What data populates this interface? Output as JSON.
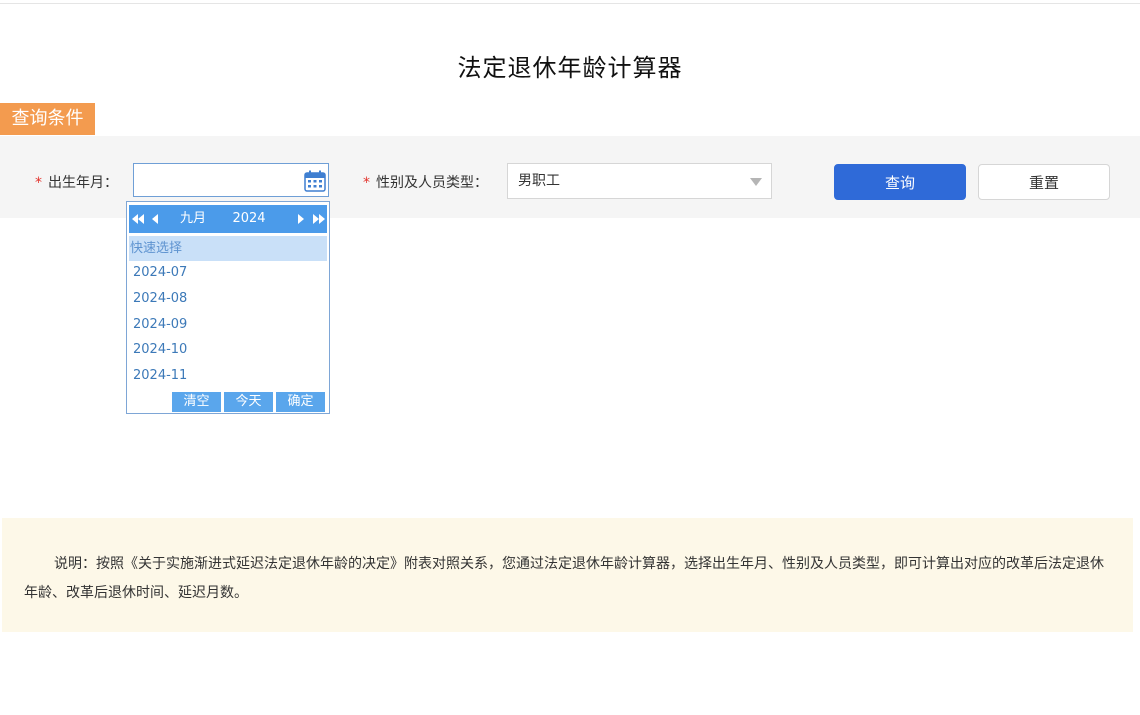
{
  "page": {
    "title": "法定退休年龄计算器"
  },
  "section": {
    "query_conditions": "查询条件"
  },
  "form": {
    "required_mark": "*",
    "birth_label": "出生年月：",
    "birth_value": "",
    "gender_label": "性别及人员类型：",
    "gender_selected": "男职工",
    "query_button": "查询",
    "reset_button": "重置"
  },
  "date_picker": {
    "month": "九月",
    "year": "2024",
    "quick_select_title": "快速选择",
    "quick_options": [
      "2024-07",
      "2024-08",
      "2024-09",
      "2024-10",
      "2024-11"
    ],
    "clear_button": "清空",
    "today_button": "今天",
    "confirm_button": "确定"
  },
  "notice": {
    "text": "说明：按照《关于实施渐进式延迟法定退休年龄的决定》附表对照关系，您通过法定退休年龄计算器，选择出生年月、性别及人员类型，即可计算出对应的改革后法定退休年龄、改革后退休时间、延迟月数。"
  },
  "icons": [
    "calendar-icon",
    "chevron-down-icon",
    "double-left-icon",
    "left-icon",
    "right-icon",
    "double-right-icon"
  ],
  "colors": {
    "accent_orange": "#f39b4f",
    "primary_blue": "#2f6ad8",
    "picker_blue": "#4b9bea",
    "notice_bg": "#fdf8e8"
  }
}
